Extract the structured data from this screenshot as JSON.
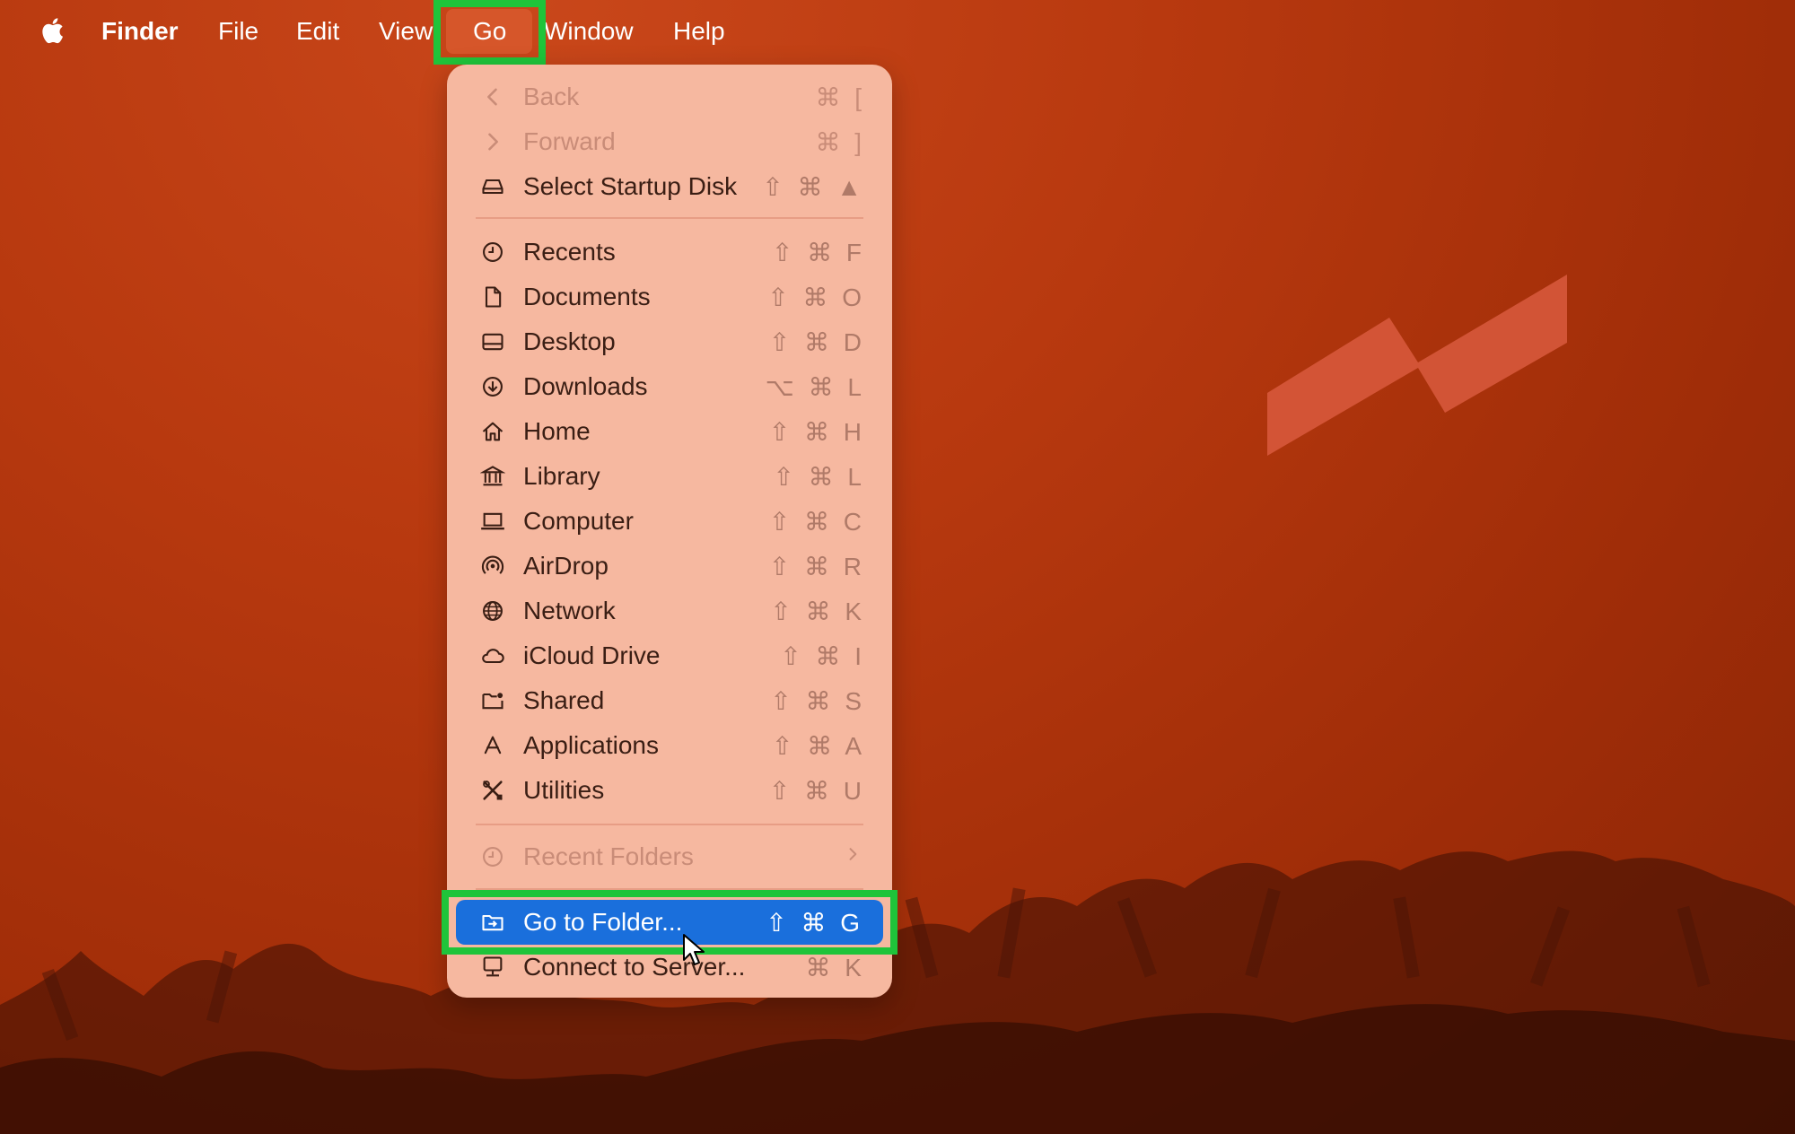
{
  "menubar": {
    "app_name": "Finder",
    "items": [
      "File",
      "Edit",
      "View",
      "Go",
      "Window",
      "Help"
    ]
  },
  "go_menu": {
    "items": [
      {
        "label": "Back",
        "shortcut": "⌘ [",
        "icon": "chevron-left-icon",
        "disabled": true
      },
      {
        "label": "Forward",
        "shortcut": "⌘ ]",
        "icon": "chevron-right-icon",
        "disabled": true
      },
      {
        "label": "Select Startup Disk",
        "shortcut": "⇧ ⌘ ▲",
        "icon": "disk-icon"
      },
      {
        "label": "Recents",
        "shortcut": "⇧ ⌘ F",
        "icon": "clock-icon"
      },
      {
        "label": "Documents",
        "shortcut": "⇧ ⌘ O",
        "icon": "document-icon"
      },
      {
        "label": "Desktop",
        "shortcut": "⇧ ⌘ D",
        "icon": "desktop-icon"
      },
      {
        "label": "Downloads",
        "shortcut": "⌥ ⌘ L",
        "icon": "download-icon"
      },
      {
        "label": "Home",
        "shortcut": "⇧ ⌘ H",
        "icon": "home-icon"
      },
      {
        "label": "Library",
        "shortcut": "⇧ ⌘ L",
        "icon": "library-icon"
      },
      {
        "label": "Computer",
        "shortcut": "⇧ ⌘ C",
        "icon": "laptop-icon"
      },
      {
        "label": "AirDrop",
        "shortcut": "⇧ ⌘ R",
        "icon": "airdrop-icon"
      },
      {
        "label": "Network",
        "shortcut": "⇧ ⌘ K",
        "icon": "globe-icon"
      },
      {
        "label": "iCloud Drive",
        "shortcut": "⇧ ⌘ I",
        "icon": "cloud-icon"
      },
      {
        "label": "Shared",
        "shortcut": "⇧ ⌘ S",
        "icon": "shared-folder-icon"
      },
      {
        "label": "Applications",
        "shortcut": "⇧ ⌘ A",
        "icon": "applications-icon"
      },
      {
        "label": "Utilities",
        "shortcut": "⇧ ⌘ U",
        "icon": "tools-icon"
      },
      {
        "label": "Recent Folders",
        "shortcut": "",
        "icon": "clock-icon",
        "disabled": true,
        "submenu": true
      },
      {
        "label": "Go to Folder...",
        "shortcut": "⇧ ⌘ G",
        "icon": "folder-arrow-icon",
        "selected": true
      },
      {
        "label": "Connect to Server...",
        "shortcut": "⌘ K",
        "icon": "server-icon"
      }
    ]
  },
  "colors": {
    "selection": "#1a6fdc",
    "highlight_outline": "#1fc43a",
    "menu_bg": "#f6b8a0"
  }
}
